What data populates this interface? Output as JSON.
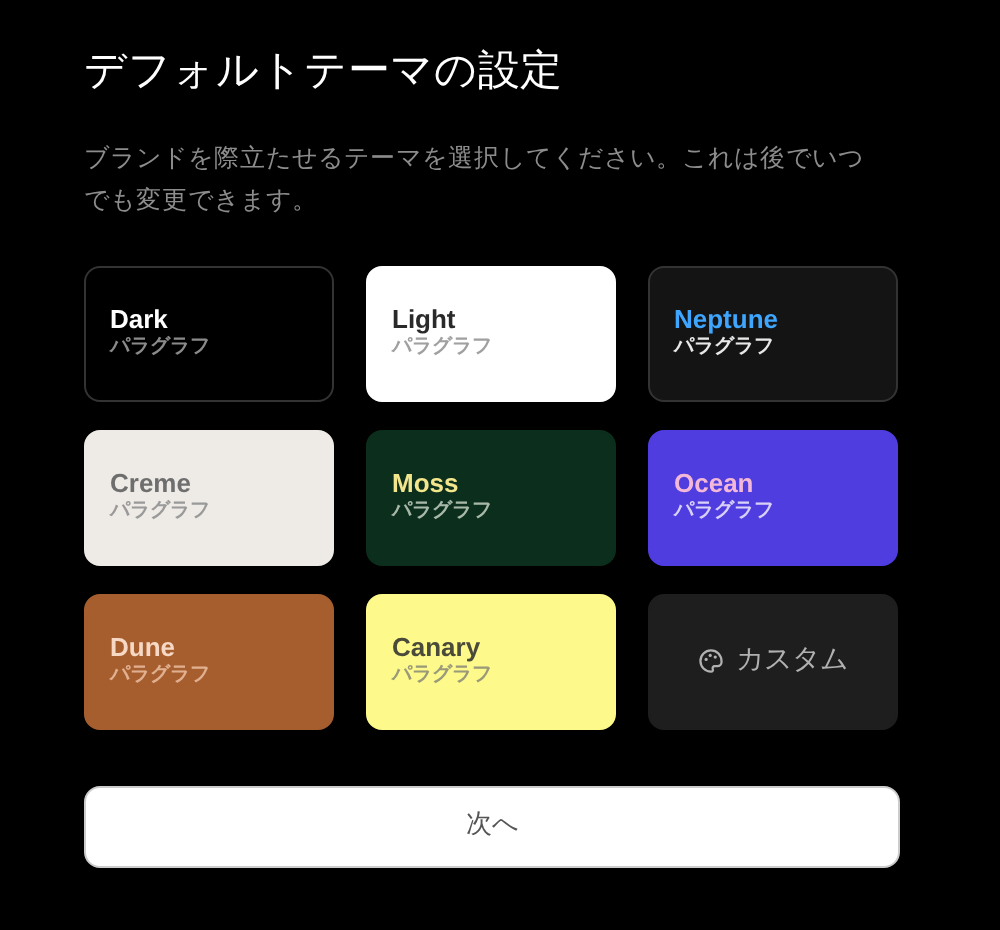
{
  "title": "デフォルトテーマの設定",
  "description": "ブランドを際立たせるテーマを選択してください。これは後でいつでも変更できます。",
  "themes": [
    {
      "kind": "theme",
      "color": "#000000",
      "name": {
        "text": "Dark",
        "color": "#ffffff"
      },
      "subtitle": {
        "text": "パラグラフ",
        "color": "#8a8a8a"
      }
    },
    {
      "kind": "theme",
      "color": "#ffffff",
      "name": {
        "text": "Light",
        "color": "#2a2a2a"
      },
      "subtitle": {
        "text": "パラグラフ",
        "color": "#a0a0a0"
      }
    },
    {
      "kind": "theme",
      "color": "#141414",
      "name": {
        "text": "Neptune",
        "color": "#3ea6ff"
      },
      "subtitle": {
        "text": "パラグラフ",
        "color": "#e8e8e8"
      }
    },
    {
      "kind": "theme",
      "color": "#eeebe6",
      "name": {
        "text": "Creme",
        "color": "#6e6e6e"
      },
      "subtitle": {
        "text": "パラグラフ",
        "color": "#9a9a9a"
      }
    },
    {
      "kind": "theme",
      "color": "#0c2e1c",
      "name": {
        "text": "Moss",
        "color": "#f2e58c"
      },
      "subtitle": {
        "text": "パラグラフ",
        "color": "#a8b8a8"
      }
    },
    {
      "kind": "theme",
      "color": "#4f3de0",
      "name": {
        "text": "Ocean",
        "color": "#f3b8d8"
      },
      "subtitle": {
        "text": "パラグラフ",
        "color": "#d8d0f8"
      }
    },
    {
      "kind": "theme",
      "color": "#a65e2e",
      "name": {
        "text": "Dune",
        "color": "#f6d8c4"
      },
      "subtitle": {
        "text": "パラグラフ",
        "color": "#e0b090"
      }
    },
    {
      "kind": "theme",
      "color": "#fdf98a",
      "name": {
        "text": "Canary",
        "color": "#4a4a3a"
      },
      "subtitle": {
        "text": "パラグラフ",
        "color": "#9a9a7a"
      }
    },
    {
      "kind": "custom",
      "color": "#1e1e1e",
      "name": {
        "text": "カスタム",
        "color": "#b0b0b0"
      }
    }
  ],
  "next_button": "次へ"
}
